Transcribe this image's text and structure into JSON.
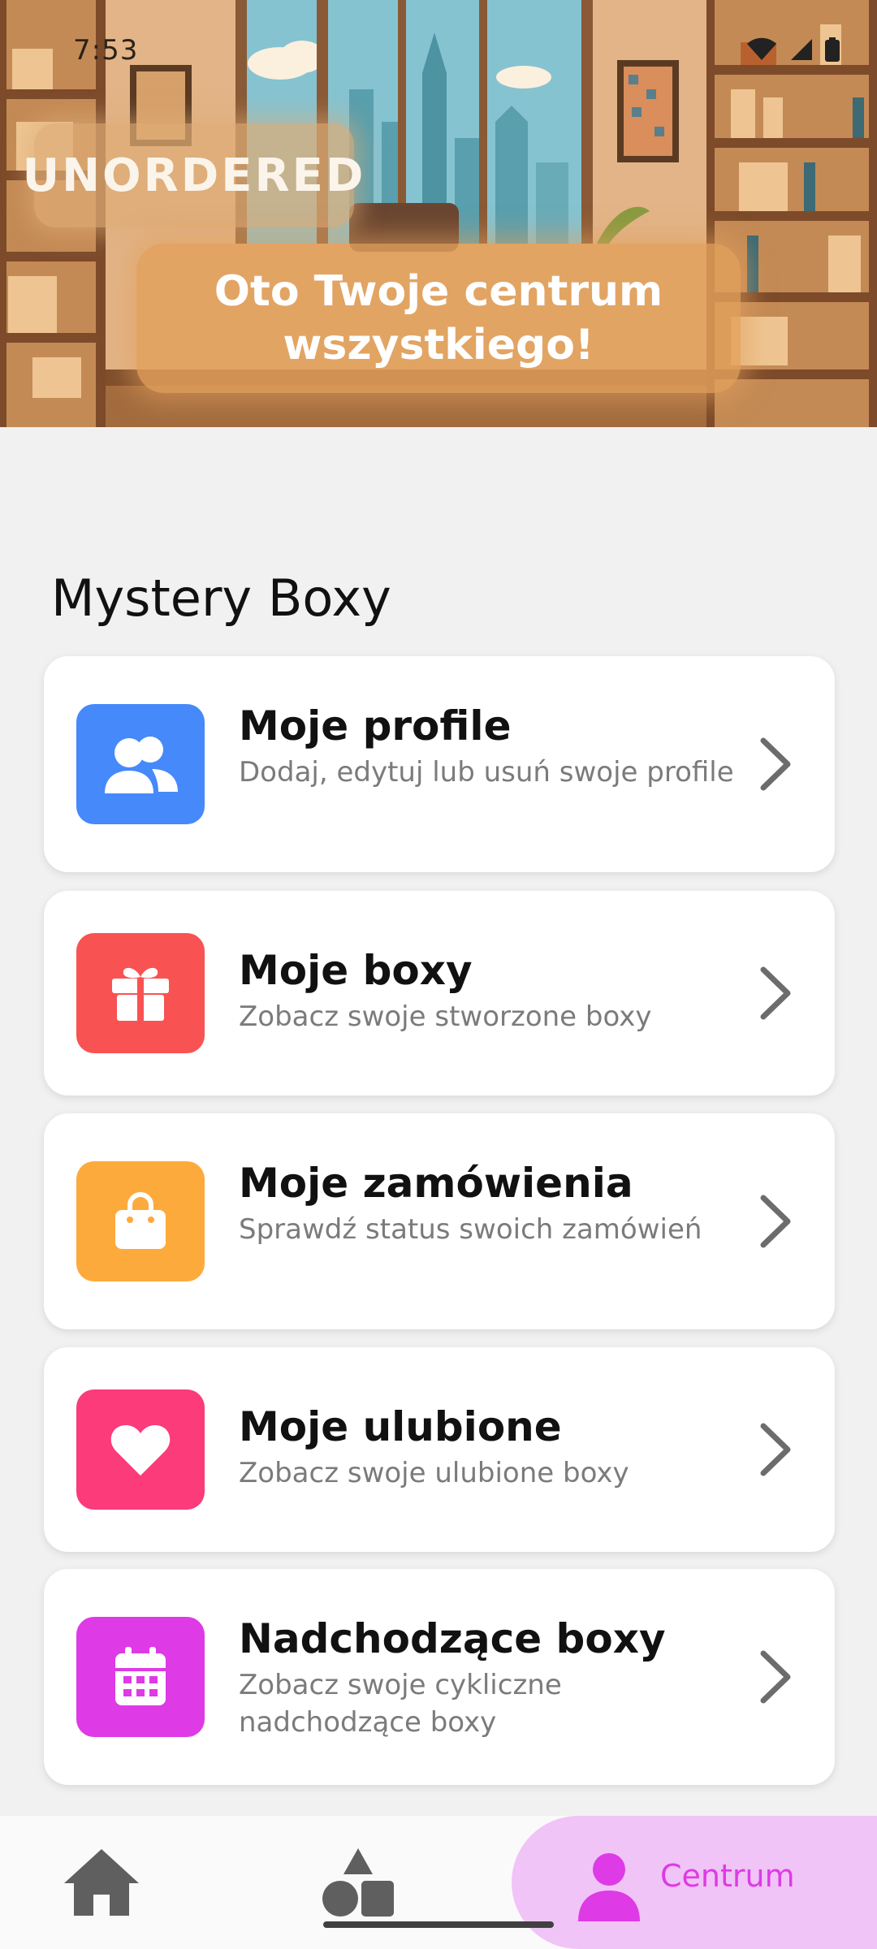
{
  "status_bar": {
    "time": "7:53",
    "icons": [
      "wifi-icon",
      "signal-icon",
      "battery-icon"
    ]
  },
  "hero": {
    "logo": "UNORDERED",
    "headline": "Oto Twoje centrum wszystkiego!"
  },
  "section": {
    "title": "Mystery Boxy"
  },
  "cards": [
    {
      "title": "Moje profile",
      "subtitle": "Dodaj, edytuj lub usuń swoje profile",
      "icon": "users-icon",
      "color": "#4589fb"
    },
    {
      "title": "Moje boxy",
      "subtitle": "Zobacz swoje stworzone boxy",
      "icon": "gift-icon",
      "color": "#f95252"
    },
    {
      "title": "Moje zamówienia",
      "subtitle": "Sprawdź status swoich zamówień",
      "icon": "shopping-bag-icon",
      "color": "#fdaa3c"
    },
    {
      "title": "Moje ulubione",
      "subtitle": "Zobacz swoje ulubione boxy",
      "icon": "heart-icon",
      "color": "#fb3b7a"
    },
    {
      "title": "Nadchodzące boxy",
      "subtitle": "Zobacz swoje cykliczne nadchodzące boxy",
      "icon": "calendar-icon",
      "color": "#de3ae6"
    }
  ],
  "bottom_nav": {
    "items": [
      {
        "icon": "home-icon",
        "label": ""
      },
      {
        "icon": "shapes-icon",
        "label": ""
      },
      {
        "icon": "person-icon",
        "label": "Centrum"
      }
    ],
    "active_index": 2,
    "active_color": "#de3ae6",
    "active_bg": "#f0c4f6"
  }
}
